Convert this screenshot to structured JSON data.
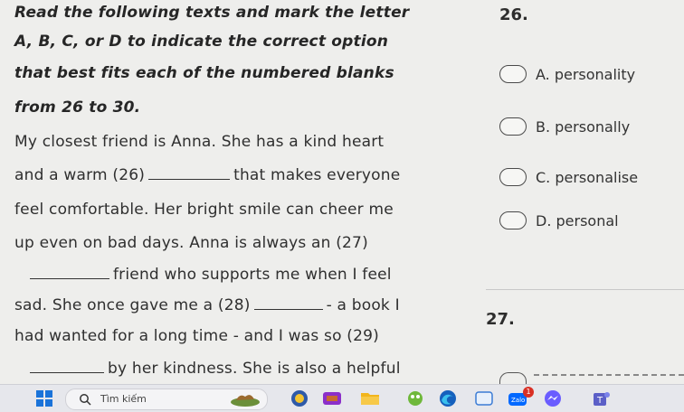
{
  "passage": {
    "lines": [
      "Read the following texts and mark the letter",
      "A, B, C, or D to indicate the correct option",
      "that best fits each of the numbered blanks",
      "from 26 to 30.",
      "My closest friend is Anna. She has a kind heart",
      "that makes everyone",
      "feel comfortable. Her bright smile can cheer me",
      "up even on bad days. Anna is always an (27)",
      "friend who supports me when I feel",
      "- a book I",
      "had wanted for a long time - and I was so (29)",
      "by her kindness. She is also a helpful"
    ],
    "line6_prefix": "and a warm (26)",
    "line10_prefix": "sad. She once gave me a (28)"
  },
  "questions": [
    {
      "number": "26.",
      "options": [
        "A. personality",
        "B. personally",
        "C. personalise",
        "D. personal"
      ]
    },
    {
      "number": "27."
    }
  ],
  "taskbar": {
    "search_placeholder": "Tìm kiếm",
    "badge_count": "1"
  },
  "colors": {
    "background": "#eeeeec",
    "taskbar": "#e6e7ec",
    "windows_blue": "#1a73d9",
    "edge_blue": "#1560bd",
    "badge_red": "#d93025"
  }
}
